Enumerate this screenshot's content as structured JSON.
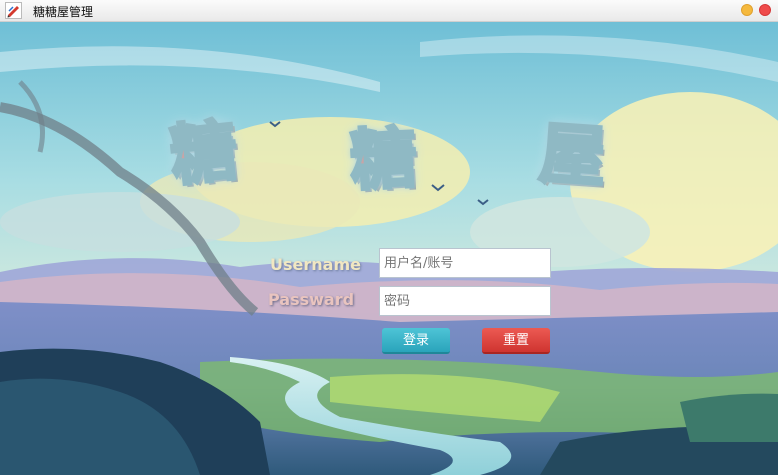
{
  "window": {
    "title": "糖糖屋管理"
  },
  "logo": {
    "chars": [
      "糖",
      "糖",
      "屋"
    ]
  },
  "form": {
    "username_label": "Username",
    "password_label": "Passward",
    "username_placeholder": "用户名/账号",
    "password_placeholder": "密码",
    "login_label": "登录",
    "reset_label": "重置"
  },
  "colors": {
    "login_button": "#2aa4bb",
    "reset_button": "#cf3430",
    "minimize_button": "#f5b93d",
    "close_button": "#ef4b4b"
  },
  "icons": {
    "app": "pencil-feather-icon"
  }
}
